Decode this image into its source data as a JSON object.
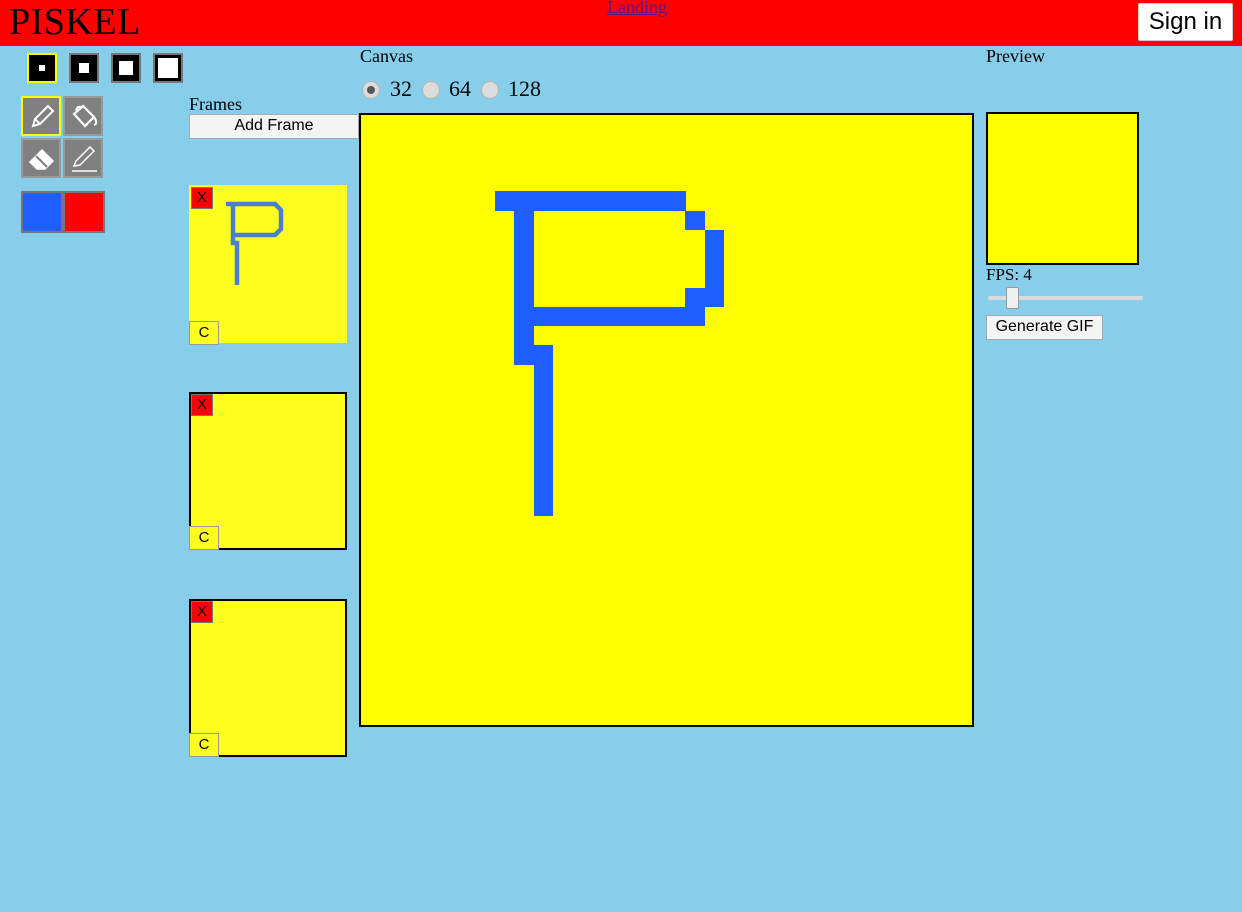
{
  "header": {
    "logo": "PISKEL",
    "landing_link": "Landing",
    "sign_in": "Sign in",
    "bar_color": "#ff0000"
  },
  "pen_sizes": {
    "options": [
      "size-1",
      "size-2",
      "size-3",
      "size-4"
    ],
    "selected": "size-1"
  },
  "tools": [
    {
      "name": "pencil-icon",
      "selected": true
    },
    {
      "name": "paint-bucket-icon",
      "selected": false
    },
    {
      "name": "eraser-icon",
      "selected": false
    },
    {
      "name": "stroke-pen-icon",
      "selected": false
    }
  ],
  "colors": {
    "primary": "#1e5eff",
    "secondary": "#ff0000"
  },
  "frames": {
    "label": "Frames",
    "add_button": "Add Frame",
    "delete_label": "X",
    "copy_label": "C",
    "items": [
      {
        "thumbnail": "P glyph",
        "selected": true
      },
      {
        "thumbnail": "empty",
        "selected": false
      },
      {
        "thumbnail": "empty",
        "selected": false
      }
    ]
  },
  "canvas": {
    "label": "Canvas",
    "size_options": [
      "32",
      "64",
      "128"
    ],
    "selected_size": "32",
    "background": "#ffff00",
    "drawing_color": "#1e5eff"
  },
  "preview": {
    "label": "Preview",
    "fps_label": "FPS: 4",
    "fps": 4,
    "generate_button": "Generate GIF"
  }
}
